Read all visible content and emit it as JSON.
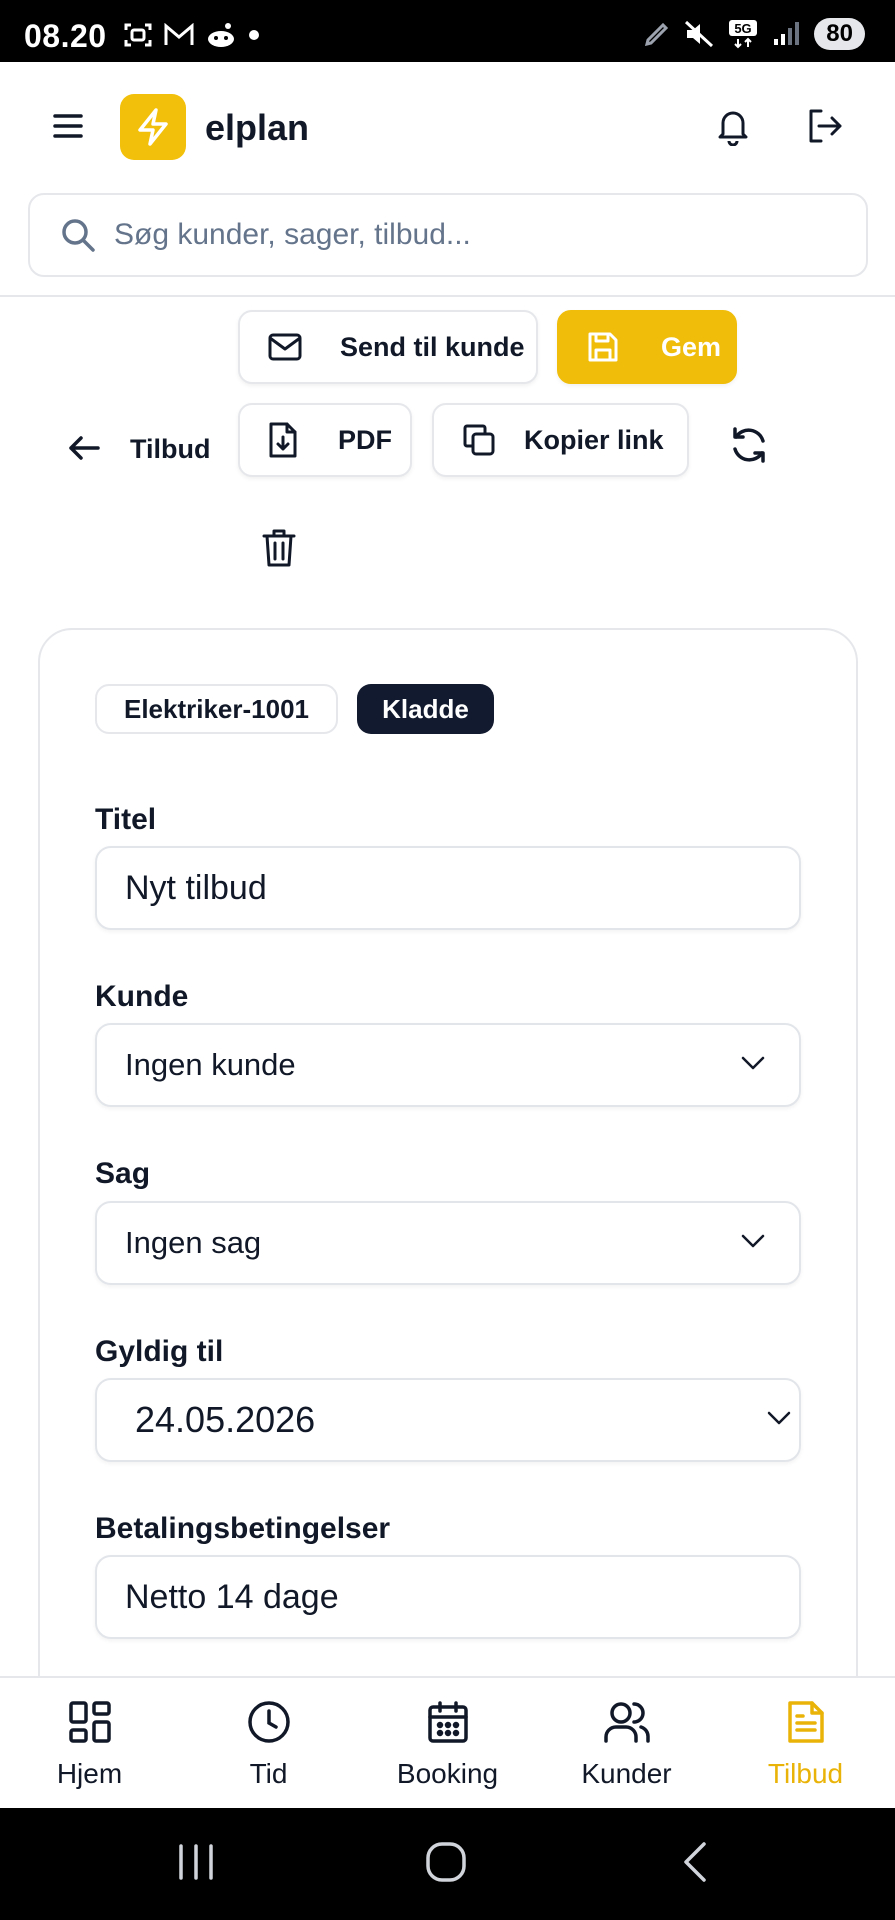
{
  "status_bar": {
    "time": "08.20",
    "battery": "80"
  },
  "header": {
    "brand": "elplan"
  },
  "search": {
    "placeholder": "Søg kunder, sager, tilbud..."
  },
  "actions": {
    "send_label": "Send til kunde",
    "save_label": "Gem",
    "pdf_label": "PDF",
    "copy_label": "Kopier link",
    "back_label": "Tilbud"
  },
  "card": {
    "number_chip": "Elektriker-1001",
    "status_chip": "Kladde",
    "fields": {
      "title_label": "Titel",
      "title_value": "Nyt tilbud",
      "customer_label": "Kunde",
      "customer_value": "Ingen kunde",
      "case_label": "Sag",
      "case_value": "Ingen sag",
      "valid_label": "Gyldig til",
      "valid_value": "24.05.2026",
      "terms_label": "Betalingsbetingelser",
      "terms_value": "Netto 14 dage"
    }
  },
  "nav": {
    "items": [
      {
        "label": "Hjem",
        "icon": "grid-icon"
      },
      {
        "label": "Tid",
        "icon": "clock-icon"
      },
      {
        "label": "Booking",
        "icon": "calendar-icon"
      },
      {
        "label": "Kunder",
        "icon": "users-icon"
      },
      {
        "label": "Tilbud",
        "icon": "document-icon",
        "active": true
      }
    ]
  },
  "colors": {
    "accent": "#efbd0a",
    "dark_chip": "#111a2e",
    "border": "#e5e7eb"
  }
}
